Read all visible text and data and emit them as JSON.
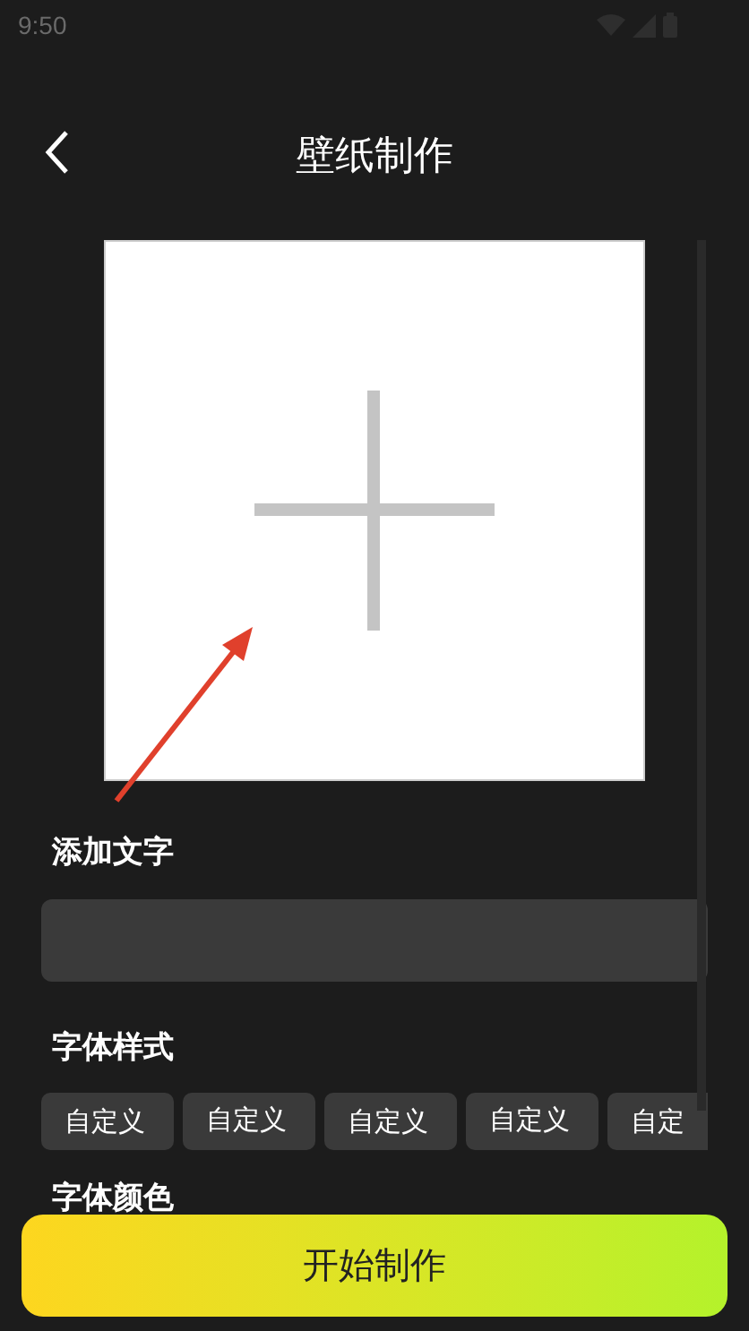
{
  "status_bar": {
    "time": "9:50"
  },
  "header": {
    "title": "壁纸制作"
  },
  "add_text": {
    "label": "添加文字"
  },
  "font_style": {
    "label": "字体样式",
    "options": [
      {
        "label": "自定义"
      },
      {
        "label": "自定义"
      },
      {
        "label": "自定义"
      },
      {
        "label": "自定义"
      },
      {
        "label": "自定"
      }
    ]
  },
  "font_color": {
    "label": "字体颜色"
  },
  "start_button": {
    "label": "开始制作"
  }
}
